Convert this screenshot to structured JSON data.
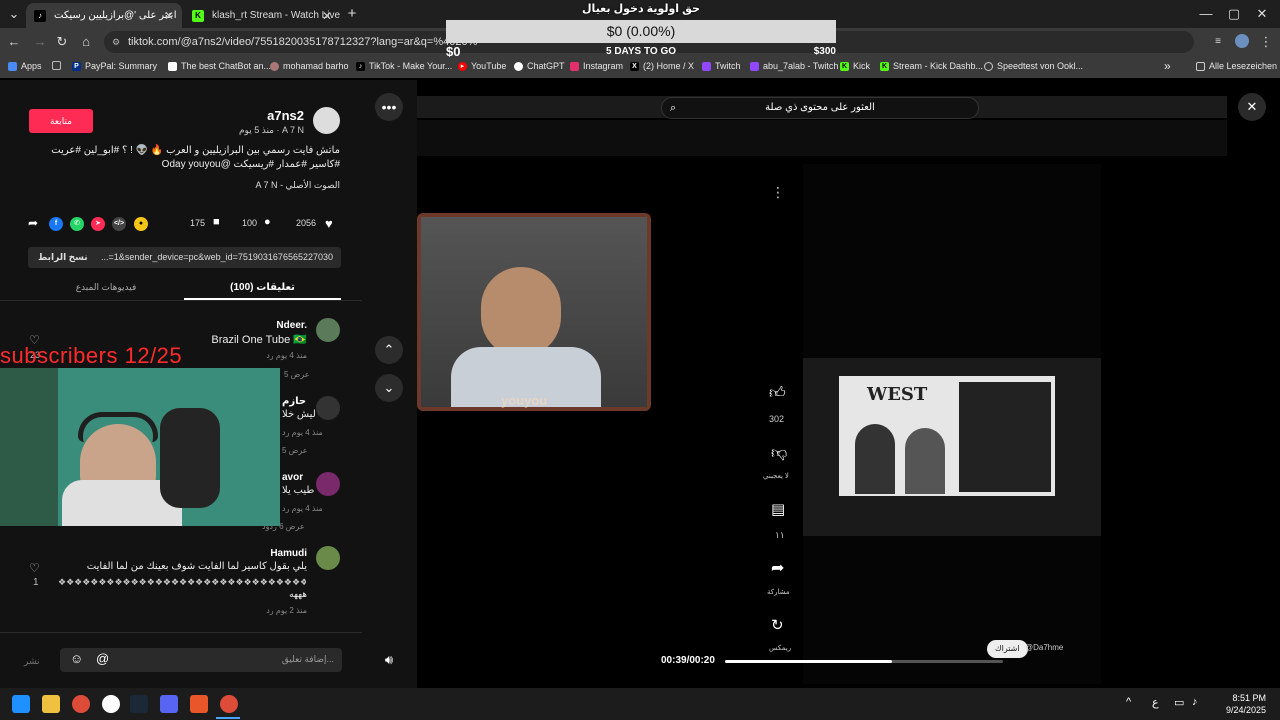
{
  "browser": {
    "tabs": [
      {
        "label": "اعثر على '@برازيليين رسيكت",
        "active": true
      },
      {
        "label": "klash_rt Stream - Watch Live on",
        "active": false
      }
    ],
    "new_tab": "+",
    "url": "tiktok.com/@a7ns2/video/7551820035178712327?lang=ar&q=%4020%",
    "window_controls": {
      "minimize": "—",
      "maximize": "▢",
      "close": "✕"
    },
    "bookmarks": [
      {
        "label": "Apps"
      },
      {
        "label": "PayPal: Summary"
      },
      {
        "label": "The best ChatBot an..."
      },
      {
        "label": "mohamad barho"
      },
      {
        "label": "TikTok - Make Your..."
      },
      {
        "label": "YouTube"
      },
      {
        "label": "ChatGPT"
      },
      {
        "label": "Instagram"
      },
      {
        "label": "(2) Home / X"
      },
      {
        "label": "Twitch"
      },
      {
        "label": "abu_7alab - Twitch"
      },
      {
        "label": "Kick"
      },
      {
        "label": "Stream - Kick Dashb..."
      },
      {
        "label": "Speedtest von Ookl..."
      }
    ],
    "bookmarks_more": "»",
    "all_bookmarks": "Alle Lesezeichen"
  },
  "donation": {
    "title": "حق اولوية دخول بعيال",
    "amount": "$0 (0.00%)",
    "min": "$0",
    "days": "5 DAYS TO GO",
    "goal": "$300"
  },
  "post": {
    "follow_label": "متابعة",
    "username": "a7ns2",
    "display_meta": "A 7 N · منذ 5 يوم",
    "caption": "ماتش فايت رسمي بين البرازيليين و العرب 🔥 👽 ! ؟ #ابو_لين #عريت #كاسير #عمدار #ريسيكت @Oday youyou",
    "sound": "الصوت الأصلي - A 7 N",
    "likes": "2056",
    "comments": "100",
    "saves": "175",
    "copy_text": "...=1&sender_device=pc&web_id=7519031676565227030",
    "copy_label": "نسخ الرابط",
    "tab_comments": "تعليقات (100)",
    "tab_creator": "فيديوهات المبدع"
  },
  "comments": [
    {
      "name": "Ndeer.",
      "text": "Brazil One Tube 🇧🇷",
      "meta": "منذ 4 يوم   رد",
      "likes": "23",
      "replies": "عرض 5"
    },
    {
      "name": "حازم",
      "text": "ليش خلا",
      "meta": "منذ 4 يوم   رد",
      "likes": "",
      "replies": "عرض 5"
    },
    {
      "name": "avor",
      "text": "طيب يلا",
      "meta": "منذ 4 يوم   رد",
      "likes": "",
      "replies": "عرض 6 ردود"
    },
    {
      "name": "Hamudi",
      "text": "يلي بقول كاسير لما الفايت شوف بعينك من لما الفايت",
      "text2": "هههه",
      "meta": "منذ 2 يوم   رد",
      "likes": "1",
      "replies": ""
    }
  ],
  "comment_input": {
    "placeholder": "إضافة تعليق...",
    "post_label": "نشر"
  },
  "overlay": {
    "subscribers": "subscribers 12/25"
  },
  "video": {
    "search_text": "العثور على محتوى ذي صلة",
    "like_count": "302",
    "dislike_label": "لا يعجبني",
    "comment_count": "١١",
    "share_label": "مشاركة",
    "remix_label": "ريمكس",
    "time": "00:39/00:20",
    "progress": 0.6,
    "watermark_left": "youyou",
    "west_label": "WEST",
    "handle": "@Da7hme",
    "subscribe_small": "اشتراك"
  },
  "taskbar": {
    "time": "8:51 PM",
    "date": "9/24/2025",
    "lang": "ع"
  }
}
